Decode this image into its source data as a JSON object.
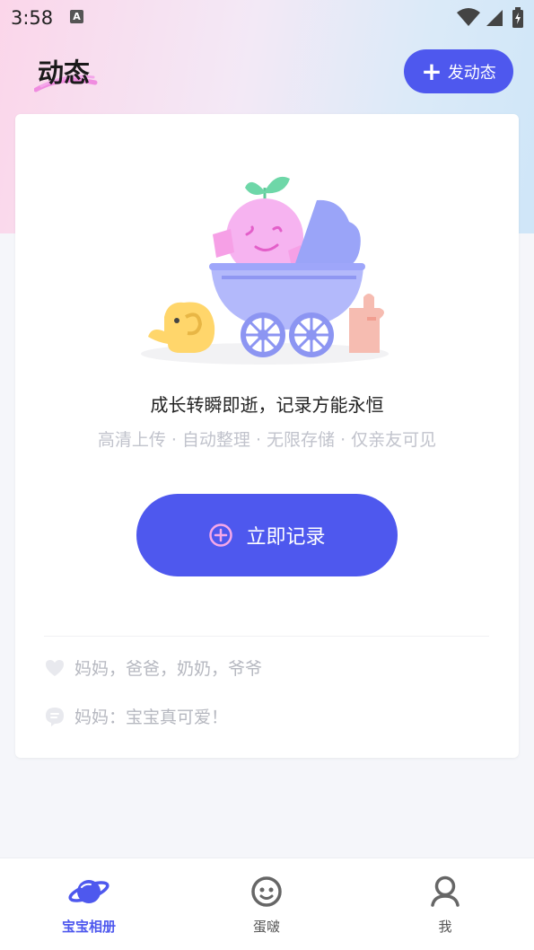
{
  "status_bar": {
    "time": "3:58",
    "notification_glyph": "A"
  },
  "header": {
    "title": "动态",
    "post_button_label": "发动态",
    "post_button_icon": "plus-icon"
  },
  "card": {
    "headline": "成长转瞬即逝，记录方能永恒",
    "subline": "高清上传 · 自动整理 · 无限存储 · 仅亲友可见",
    "record_button_label": "立即记录",
    "likes_text": "妈妈，爸爸，奶奶，爷爷",
    "comment_text": "妈妈：宝宝真可爱！"
  },
  "tabbar": {
    "items": [
      {
        "label": "宝宝相册",
        "icon": "planet-icon",
        "active": true
      },
      {
        "label": "蛋啵",
        "icon": "face-icon",
        "active": false
      },
      {
        "label": "我",
        "icon": "profile-icon",
        "active": false
      }
    ]
  },
  "colors": {
    "accent": "#4e58ee",
    "muted_text": "#b6b8c0",
    "pink": "#f6a8e8"
  }
}
